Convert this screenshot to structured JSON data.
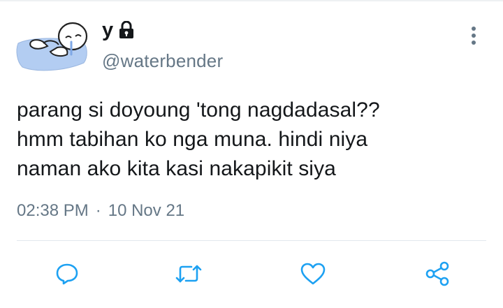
{
  "tweet": {
    "author_name": "y",
    "handle": "@waterbender",
    "text_lines": [
      "parang si doyoung 'tong nagdadasal??",
      "hmm tabihan ko nga muna. hindi niya",
      "naman ako kita kasi nakapikit siya"
    ],
    "time": "02:38 PM",
    "separator": "·",
    "date": "10 Nov 21"
  },
  "icons": {
    "avatar": "sleeping-cartoon-avatar",
    "protected": "lock-icon",
    "more": "vertical-dots-icon",
    "actions": [
      "reply-icon",
      "retweet-icon",
      "like-icon",
      "share-icon"
    ]
  },
  "colors": {
    "text": "#14171a",
    "secondary": "#657786",
    "icon": "#1da1f2",
    "avatar_blue": "#b3cdf2"
  }
}
